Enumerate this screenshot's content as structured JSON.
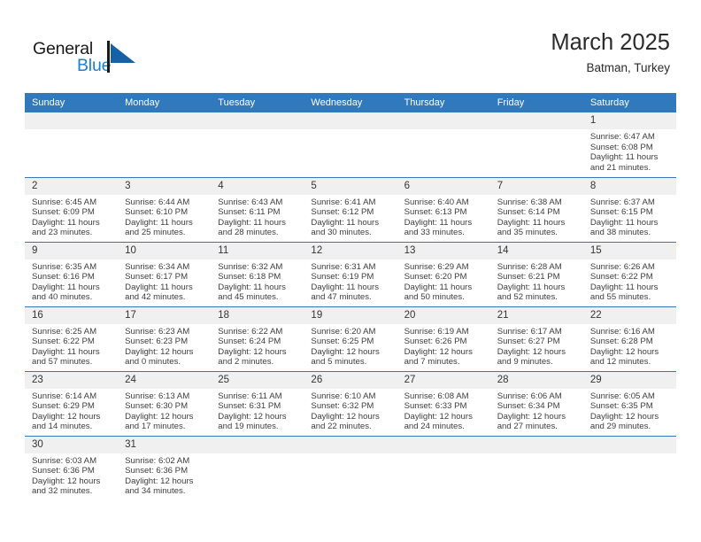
{
  "brand": {
    "name_part1": "General",
    "name_part2": "Blue",
    "logo_icon": "blue-triangle-flag-icon",
    "accent_color": "#1b7fd4"
  },
  "header": {
    "title": "March 2025",
    "subtitle": "Batman, Turkey"
  },
  "calendar": {
    "header_bg": "#3079bd",
    "daynum_bg": "#f0f0f0",
    "weekdays": [
      "Sunday",
      "Monday",
      "Tuesday",
      "Wednesday",
      "Thursday",
      "Friday",
      "Saturday"
    ],
    "weeks": [
      [
        {
          "day": "",
          "empty": true
        },
        {
          "day": "",
          "empty": true
        },
        {
          "day": "",
          "empty": true
        },
        {
          "day": "",
          "empty": true
        },
        {
          "day": "",
          "empty": true
        },
        {
          "day": "",
          "empty": true
        },
        {
          "day": "1",
          "sunrise": "Sunrise: 6:47 AM",
          "sunset": "Sunset: 6:08 PM",
          "daylight1": "Daylight: 11 hours",
          "daylight2": "and 21 minutes."
        }
      ],
      [
        {
          "day": "2",
          "sunrise": "Sunrise: 6:45 AM",
          "sunset": "Sunset: 6:09 PM",
          "daylight1": "Daylight: 11 hours",
          "daylight2": "and 23 minutes."
        },
        {
          "day": "3",
          "sunrise": "Sunrise: 6:44 AM",
          "sunset": "Sunset: 6:10 PM",
          "daylight1": "Daylight: 11 hours",
          "daylight2": "and 25 minutes."
        },
        {
          "day": "4",
          "sunrise": "Sunrise: 6:43 AM",
          "sunset": "Sunset: 6:11 PM",
          "daylight1": "Daylight: 11 hours",
          "daylight2": "and 28 minutes."
        },
        {
          "day": "5",
          "sunrise": "Sunrise: 6:41 AM",
          "sunset": "Sunset: 6:12 PM",
          "daylight1": "Daylight: 11 hours",
          "daylight2": "and 30 minutes."
        },
        {
          "day": "6",
          "sunrise": "Sunrise: 6:40 AM",
          "sunset": "Sunset: 6:13 PM",
          "daylight1": "Daylight: 11 hours",
          "daylight2": "and 33 minutes."
        },
        {
          "day": "7",
          "sunrise": "Sunrise: 6:38 AM",
          "sunset": "Sunset: 6:14 PM",
          "daylight1": "Daylight: 11 hours",
          "daylight2": "and 35 minutes."
        },
        {
          "day": "8",
          "sunrise": "Sunrise: 6:37 AM",
          "sunset": "Sunset: 6:15 PM",
          "daylight1": "Daylight: 11 hours",
          "daylight2": "and 38 minutes."
        }
      ],
      [
        {
          "day": "9",
          "sunrise": "Sunrise: 6:35 AM",
          "sunset": "Sunset: 6:16 PM",
          "daylight1": "Daylight: 11 hours",
          "daylight2": "and 40 minutes."
        },
        {
          "day": "10",
          "sunrise": "Sunrise: 6:34 AM",
          "sunset": "Sunset: 6:17 PM",
          "daylight1": "Daylight: 11 hours",
          "daylight2": "and 42 minutes."
        },
        {
          "day": "11",
          "sunrise": "Sunrise: 6:32 AM",
          "sunset": "Sunset: 6:18 PM",
          "daylight1": "Daylight: 11 hours",
          "daylight2": "and 45 minutes."
        },
        {
          "day": "12",
          "sunrise": "Sunrise: 6:31 AM",
          "sunset": "Sunset: 6:19 PM",
          "daylight1": "Daylight: 11 hours",
          "daylight2": "and 47 minutes."
        },
        {
          "day": "13",
          "sunrise": "Sunrise: 6:29 AM",
          "sunset": "Sunset: 6:20 PM",
          "daylight1": "Daylight: 11 hours",
          "daylight2": "and 50 minutes."
        },
        {
          "day": "14",
          "sunrise": "Sunrise: 6:28 AM",
          "sunset": "Sunset: 6:21 PM",
          "daylight1": "Daylight: 11 hours",
          "daylight2": "and 52 minutes."
        },
        {
          "day": "15",
          "sunrise": "Sunrise: 6:26 AM",
          "sunset": "Sunset: 6:22 PM",
          "daylight1": "Daylight: 11 hours",
          "daylight2": "and 55 minutes."
        }
      ],
      [
        {
          "day": "16",
          "sunrise": "Sunrise: 6:25 AM",
          "sunset": "Sunset: 6:22 PM",
          "daylight1": "Daylight: 11 hours",
          "daylight2": "and 57 minutes."
        },
        {
          "day": "17",
          "sunrise": "Sunrise: 6:23 AM",
          "sunset": "Sunset: 6:23 PM",
          "daylight1": "Daylight: 12 hours",
          "daylight2": "and 0 minutes."
        },
        {
          "day": "18",
          "sunrise": "Sunrise: 6:22 AM",
          "sunset": "Sunset: 6:24 PM",
          "daylight1": "Daylight: 12 hours",
          "daylight2": "and 2 minutes."
        },
        {
          "day": "19",
          "sunrise": "Sunrise: 6:20 AM",
          "sunset": "Sunset: 6:25 PM",
          "daylight1": "Daylight: 12 hours",
          "daylight2": "and 5 minutes."
        },
        {
          "day": "20",
          "sunrise": "Sunrise: 6:19 AM",
          "sunset": "Sunset: 6:26 PM",
          "daylight1": "Daylight: 12 hours",
          "daylight2": "and 7 minutes."
        },
        {
          "day": "21",
          "sunrise": "Sunrise: 6:17 AM",
          "sunset": "Sunset: 6:27 PM",
          "daylight1": "Daylight: 12 hours",
          "daylight2": "and 9 minutes."
        },
        {
          "day": "22",
          "sunrise": "Sunrise: 6:16 AM",
          "sunset": "Sunset: 6:28 PM",
          "daylight1": "Daylight: 12 hours",
          "daylight2": "and 12 minutes."
        }
      ],
      [
        {
          "day": "23",
          "sunrise": "Sunrise: 6:14 AM",
          "sunset": "Sunset: 6:29 PM",
          "daylight1": "Daylight: 12 hours",
          "daylight2": "and 14 minutes."
        },
        {
          "day": "24",
          "sunrise": "Sunrise: 6:13 AM",
          "sunset": "Sunset: 6:30 PM",
          "daylight1": "Daylight: 12 hours",
          "daylight2": "and 17 minutes."
        },
        {
          "day": "25",
          "sunrise": "Sunrise: 6:11 AM",
          "sunset": "Sunset: 6:31 PM",
          "daylight1": "Daylight: 12 hours",
          "daylight2": "and 19 minutes."
        },
        {
          "day": "26",
          "sunrise": "Sunrise: 6:10 AM",
          "sunset": "Sunset: 6:32 PM",
          "daylight1": "Daylight: 12 hours",
          "daylight2": "and 22 minutes."
        },
        {
          "day": "27",
          "sunrise": "Sunrise: 6:08 AM",
          "sunset": "Sunset: 6:33 PM",
          "daylight1": "Daylight: 12 hours",
          "daylight2": "and 24 minutes."
        },
        {
          "day": "28",
          "sunrise": "Sunrise: 6:06 AM",
          "sunset": "Sunset: 6:34 PM",
          "daylight1": "Daylight: 12 hours",
          "daylight2": "and 27 minutes."
        },
        {
          "day": "29",
          "sunrise": "Sunrise: 6:05 AM",
          "sunset": "Sunset: 6:35 PM",
          "daylight1": "Daylight: 12 hours",
          "daylight2": "and 29 minutes."
        }
      ],
      [
        {
          "day": "30",
          "sunrise": "Sunrise: 6:03 AM",
          "sunset": "Sunset: 6:36 PM",
          "daylight1": "Daylight: 12 hours",
          "daylight2": "and 32 minutes."
        },
        {
          "day": "31",
          "sunrise": "Sunrise: 6:02 AM",
          "sunset": "Sunset: 6:36 PM",
          "daylight1": "Daylight: 12 hours",
          "daylight2": "and 34 minutes."
        },
        {
          "day": "",
          "empty": true
        },
        {
          "day": "",
          "empty": true
        },
        {
          "day": "",
          "empty": true
        },
        {
          "day": "",
          "empty": true
        },
        {
          "day": "",
          "empty": true
        }
      ]
    ]
  }
}
